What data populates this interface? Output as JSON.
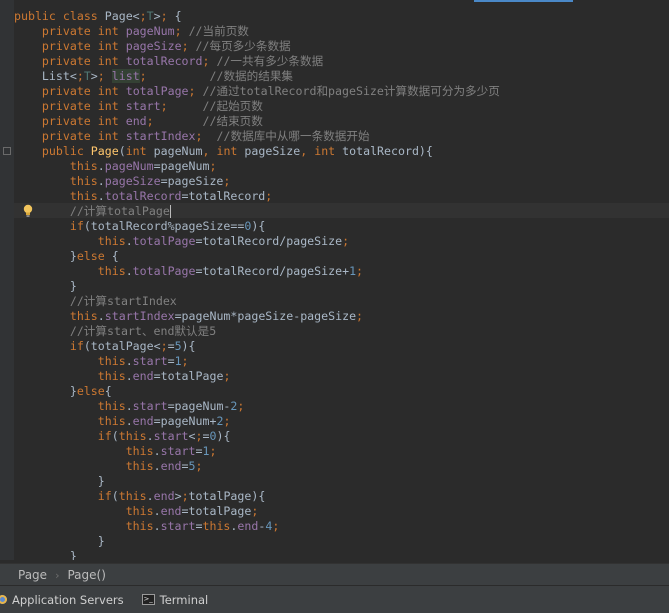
{
  "editor": {
    "lines": [
      "public class Page<T> {",
      "    private int pageNum; //当前页数",
      "    private int pageSize; //每页多少条数据",
      "    private int totalRecord; //一共有多少条数据",
      "    List<T> list;         //数据的结果集",
      "    private int totalPage; //通过totalRecord和pageSize计算数据可分为多少页",
      "    private int start;     //起始页数",
      "    private int end;       //结束页数",
      "    private int startIndex;  //数据库中从哪一条数据开始",
      "    public Page(int pageNum, int pageSize, int totalRecord){",
      "        this.pageNum=pageNum;",
      "        this.pageSize=pageSize;",
      "        this.totalRecord=totalRecord;",
      "        //计算totalPage",
      "        if(totalRecord%pageSize==0){",
      "            this.totalPage=totalRecord/pageSize;",
      "        }else {",
      "            this.totalPage=totalRecord/pageSize+1;",
      "        }",
      "        //计算startIndex",
      "        this.startIndex=pageNum*pageSize-pageSize;",
      "        //计算start、end默认是5",
      "        if(totalPage<=5){",
      "            this.start=1;",
      "            this.end=totalPage;",
      "        }else{",
      "            this.start=pageNum-2;",
      "            this.end=pageNum+2;",
      "            if(this.start<=0){",
      "                this.start=1;",
      "                this.end=5;",
      "            }",
      "            if(this.end>totalPage){",
      "                this.end=totalPage;",
      "                this.start=this.end-4;",
      "            }",
      "        }"
    ]
  },
  "breadcrumb": {
    "class_name": "Page",
    "method_name": "Page()"
  },
  "tool_windows": {
    "servers_label": "Application Servers",
    "terminal_label": "Terminal"
  },
  "icons": {
    "intention": "lightbulb-icon",
    "fold": "fold-marker-icon",
    "servers": "application-servers-icon",
    "terminal": "terminal-icon",
    "separator": "chevron-right-icon"
  },
  "colors": {
    "background": "#2b2b2b",
    "keyword": "#cc7832",
    "field": "#9876aa",
    "number": "#6897bb",
    "comment": "#808080",
    "method": "#ffc66d",
    "text": "#a9b7c6"
  }
}
